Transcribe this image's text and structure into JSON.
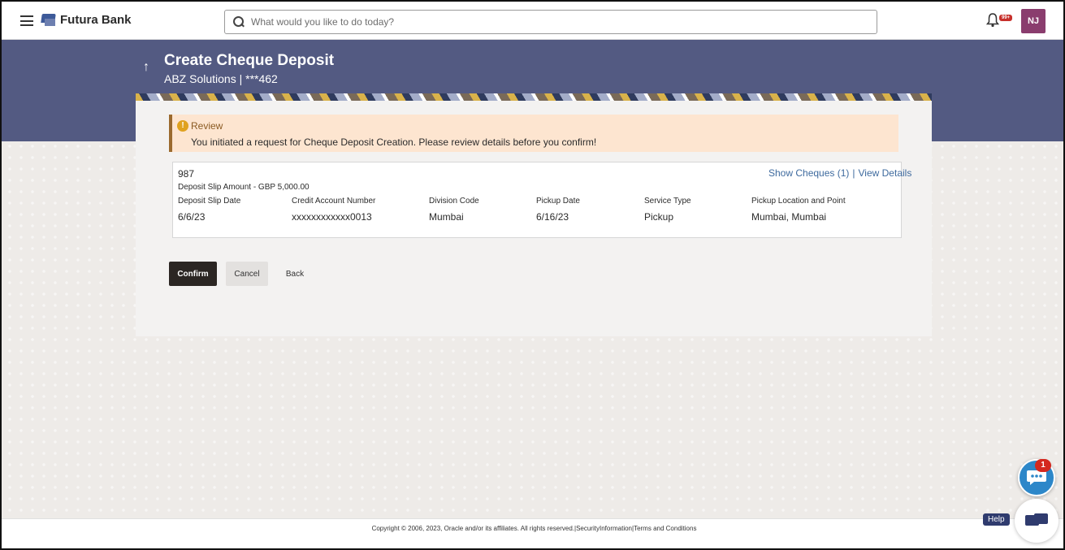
{
  "header": {
    "brand": "Futura Bank",
    "search_placeholder": "What would you like to do today?",
    "notification_badge": "99+",
    "avatar_initials": "NJ"
  },
  "banner": {
    "title": "Create Cheque Deposit",
    "subtitle": "ABZ Solutions | ***462"
  },
  "review": {
    "title": "Review",
    "message": "You initiated a request for Cheque Deposit Creation. Please review details before you confirm!"
  },
  "deposit": {
    "slip_number": "987",
    "amount_line": "Deposit Slip Amount - GBP 5,000.00",
    "show_cheques_link": "Show Cheques (1)",
    "link_separator": "|",
    "view_details_link": "View Details",
    "columns": [
      {
        "label": "Deposit Slip Date",
        "value": "6/6/23"
      },
      {
        "label": "Credit Account Number",
        "value": "xxxxxxxxxxxx0013"
      },
      {
        "label": "Division Code",
        "value": "Mumbai"
      },
      {
        "label": "Pickup Date",
        "value": "6/16/23"
      },
      {
        "label": "Service Type",
        "value": "Pickup"
      },
      {
        "label": "Pickup Location and Point",
        "value": "Mumbai, Mumbai"
      }
    ]
  },
  "actions": {
    "confirm": "Confirm",
    "cancel": "Cancel",
    "back": "Back"
  },
  "footer": {
    "copyright": "Copyright © 2006, 2023, Oracle and/or its affiliates. All rights reserved.|SecurityInformation|Terms and Conditions"
  },
  "chat": {
    "badge": "1",
    "help_label": "Help"
  },
  "colors": {
    "banner": "#535a82",
    "review_bg": "#fde5d0",
    "confirm_bg": "#2b2623",
    "link": "#3e6a9e",
    "chat": "#2d87c9"
  }
}
